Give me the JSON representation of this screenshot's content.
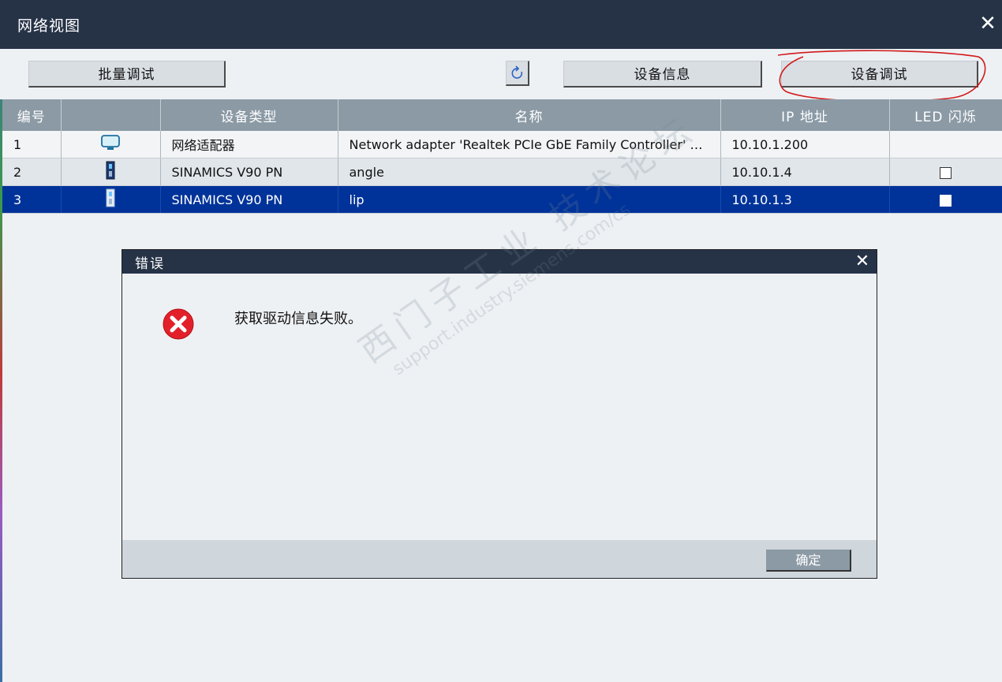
{
  "window": {
    "title": "网络视图",
    "close_glyph": "✕"
  },
  "toolbar": {
    "batch_debug_label": "批量调试",
    "refresh_icon": "refresh-icon",
    "device_info_label": "设备信息",
    "device_debug_label": "设备调试"
  },
  "table": {
    "columns": [
      "编号",
      "",
      "设备类型",
      "名称",
      "IP 地址",
      "LED 闪烁"
    ],
    "rows": [
      {
        "no": "1",
        "icon": "network-adapter-icon",
        "type": "网络适配器",
        "name": "Network adapter 'Realtek PCIe GbE Family Controller' on...",
        "ip": "10.10.1.200",
        "led": "none",
        "selected": false
      },
      {
        "no": "2",
        "icon": "drive-icon",
        "type": "SINAMICS V90 PN",
        "name": "angle",
        "ip": "10.10.1.4",
        "led": "unchecked",
        "selected": false
      },
      {
        "no": "3",
        "icon": "drive-icon",
        "type": "SINAMICS V90 PN",
        "name": "lip",
        "ip": "10.10.1.3",
        "led": "unchecked",
        "selected": true
      }
    ]
  },
  "dialog": {
    "title": "错误",
    "close_glyph": "✕",
    "icon": "error-icon",
    "message": "获取驱动信息失败。",
    "ok_label": "确定"
  },
  "watermark": {
    "line1": "西门子工业 技术论坛",
    "line2": "support.industry.siemens.com/cs"
  },
  "colors": {
    "titlebar": "#263347",
    "header": "#8b9aa5",
    "selected": "#003399",
    "annotation": "#d11a1a",
    "error": "#e3202a"
  }
}
